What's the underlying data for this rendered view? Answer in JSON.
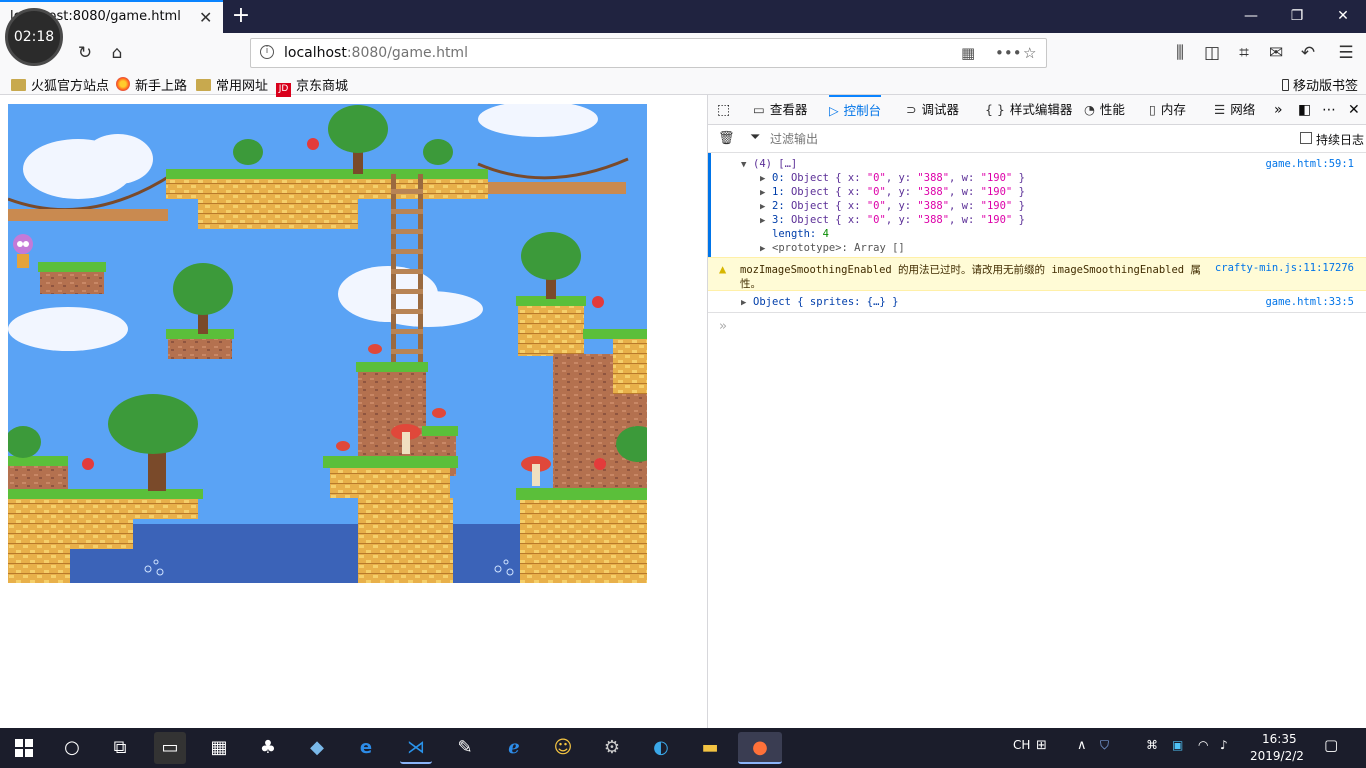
{
  "window": {
    "tab_title": "localhost:8080/game.html",
    "timer": "02:18"
  },
  "navbar": {
    "url_host": "localhost",
    "url_rest": ":8080/game.html"
  },
  "bookmarks": [
    {
      "label": "火狐官方站点",
      "icon": "folder-icon"
    },
    {
      "label": "新手上路",
      "icon": "firefox-icon"
    },
    {
      "label": "常用网址",
      "icon": "folder-icon"
    },
    {
      "label": "京东商城",
      "icon": "jd-icon"
    }
  ],
  "mobile_bookmarks": "移动版书签",
  "devtools": {
    "tabs": [
      {
        "label": "查看器",
        "icon": "inspector-icon"
      },
      {
        "label": "控制台",
        "icon": "console-icon",
        "selected": true
      },
      {
        "label": "调试器",
        "icon": "debugger-icon"
      },
      {
        "label": "样式编辑器",
        "icon": "style-editor-icon"
      },
      {
        "label": "性能",
        "icon": "performance-icon"
      },
      {
        "label": "内存",
        "icon": "memory-icon"
      },
      {
        "label": "网络",
        "icon": "network-icon"
      }
    ],
    "filter_placeholder": "过滤输出",
    "persist_label": "持续日志",
    "console": {
      "array_header": "(4) […]",
      "array_source": "game.html:59:1",
      "items": [
        {
          "index": "0",
          "x": "\"0\"",
          "y": "\"388\"",
          "w": "\"190\""
        },
        {
          "index": "1",
          "x": "\"0\"",
          "y": "\"388\"",
          "w": "\"190\""
        },
        {
          "index": "2",
          "x": "\"0\"",
          "y": "\"388\"",
          "w": "\"190\""
        },
        {
          "index": "3",
          "x": "\"0\"",
          "y": "\"388\"",
          "w": "\"190\""
        }
      ],
      "length_label": "length: ",
      "length_value": "4",
      "prototype": "<prototype>: Array []",
      "warning_line1": "mozImageSmoothingEnabled 的用法已过时。请改用无前缀的 imageSmoothingEnabled 属",
      "warning_line2": "性。",
      "warning_source": "crafty-min.js:11:17276",
      "object_text": "Object { sprites: {…} }",
      "object_source": "game.html:33:5"
    }
  },
  "taskbar": {
    "ime": "CH",
    "time": "16:35",
    "date": "2019/2/2"
  }
}
